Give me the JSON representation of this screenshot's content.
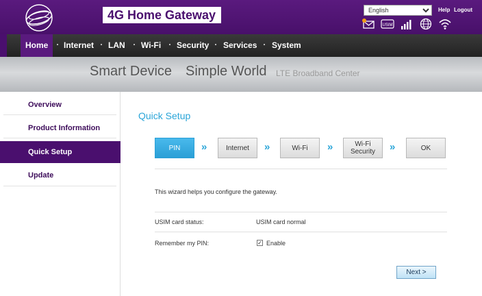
{
  "header": {
    "title": "4G Home Gateway",
    "language": "English",
    "help": "Help",
    "logout": "Logout",
    "status_icons": [
      "sms-icon",
      "usim-icon",
      "signal-icon",
      "globe-icon",
      "wifi-icon"
    ],
    "usim_label": "USIM"
  },
  "nav": {
    "items": [
      {
        "label": "Home",
        "active": true
      },
      {
        "label": "Internet"
      },
      {
        "label": "LAN"
      },
      {
        "label": "Wi-Fi"
      },
      {
        "label": "Security"
      },
      {
        "label": "Services"
      },
      {
        "label": "System"
      }
    ]
  },
  "banner": {
    "left": "Smart Device",
    "right": "Simple World",
    "sub": "LTE Broadband Center"
  },
  "sidebar": {
    "items": [
      {
        "label": "Overview"
      },
      {
        "label": "Product Information"
      },
      {
        "label": "Quick Setup",
        "active": true
      },
      {
        "label": "Update"
      }
    ]
  },
  "main": {
    "title": "Quick Setup",
    "steps": [
      "PIN",
      "Internet",
      "Wi-Fi",
      "Wi-Fi Security",
      "OK"
    ],
    "step_arrow": "»",
    "intro": "This wizard helps you configure the gateway.",
    "usim_label": "USIM card status:",
    "usim_value": "USIM card normal",
    "remember_label": "Remember my PIN:",
    "remember_checked": true,
    "remember_option": "Enable",
    "next_button": "Next >"
  },
  "colors": {
    "brand_purple": "#4a0f6e",
    "accent_blue": "#2aa5d8"
  }
}
